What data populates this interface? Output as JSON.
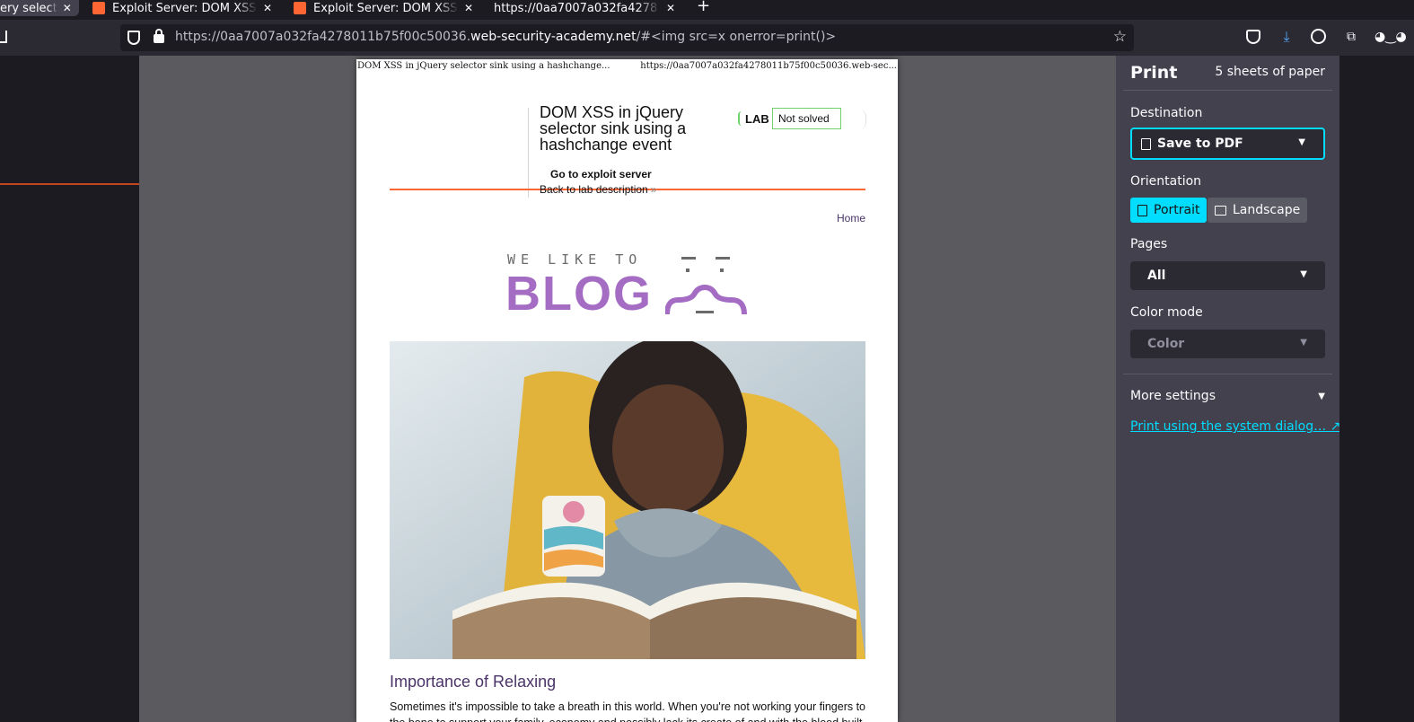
{
  "browser": {
    "tabs": [
      {
        "title": "ery select",
        "active": true
      },
      {
        "title": "Exploit Server: DOM XSS i",
        "active": false
      },
      {
        "title": "Exploit Server: DOM XSS i",
        "active": false
      },
      {
        "title": "https://0aa7007a032fa4278",
        "active": false
      }
    ],
    "close_glyph": "✕",
    "new_tab_glyph": "+",
    "url_prefix": "https://0aa7007a032fa4278011b75f00c50036.",
    "url_domain": "web-security-academy.net",
    "url_suffix": "/#<img src=x onerror=print()>"
  },
  "paper": {
    "header_left": "DOM XSS in jQuery selector sink using a hashchange...",
    "header_right": "https://0aa7007a032fa4278011b75f00c50036.web-sec...",
    "lab_title": "DOM XSS in jQuery selector sink using a hashchange event",
    "lab_badge": "LAB",
    "lab_status": "Not solved",
    "exploit_link": "Go to exploit server",
    "back_link": "Back to lab description",
    "back_chevron": "»",
    "home_link": "Home",
    "logo_small": "WE LIKE TO",
    "logo_big": "BLOG",
    "post_title": "Importance of Relaxing",
    "post_excerpt": "Sometimes it's impossible to take a breath in this world. When you're not working your fingers to the bone to support your family, economy and possibly lack its create of and with the blood built"
  },
  "print_panel": {
    "title": "Print",
    "sheets": "5 sheets of paper",
    "destination_label": "Destination",
    "destination_value": "Save to PDF",
    "orientation_label": "Orientation",
    "portrait": "Portrait",
    "landscape": "Landscape",
    "pages_label": "Pages",
    "pages_value": "All",
    "color_mode_label": "Color mode",
    "color_mode_value": "Color",
    "more_settings": "More settings",
    "system_dialog_link": "Print using the system dialog…"
  },
  "colors": {
    "accent": "#00ddff",
    "brand_orange": "#ff6633",
    "blog_purple": "#a46cc2",
    "link_purple": "#4b3468",
    "status_green": "#70d16d"
  }
}
